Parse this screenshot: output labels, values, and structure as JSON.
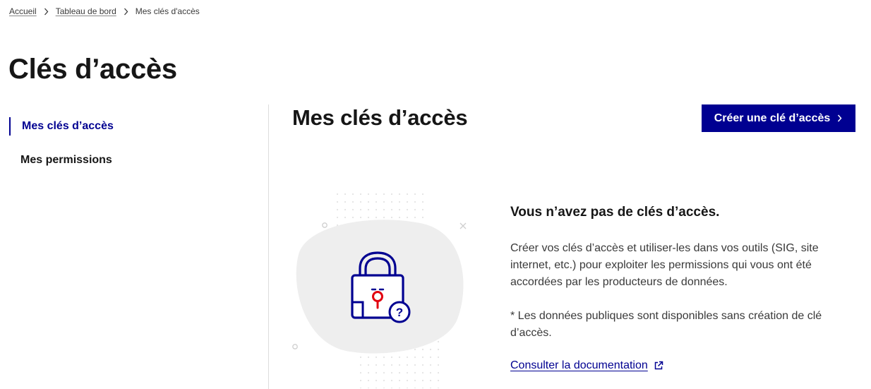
{
  "breadcrumb": {
    "items": [
      "Accueil",
      "Tableau de bord"
    ],
    "current": "Mes clés d'accès"
  },
  "page": {
    "title": "Clés d’accès"
  },
  "sidebar": {
    "items": [
      {
        "label": "Mes clés d’accès",
        "active": true
      },
      {
        "label": "Mes permissions",
        "active": false
      }
    ]
  },
  "main": {
    "title": "Mes clés d’accès",
    "create_button_label": "Créer une clé d’accès",
    "empty_state": {
      "title": "Vous n’avez pas de clés d’accès.",
      "description": "Créer vos clés d’accès et utiliser-les dans vos outils (SIG, site internet, etc.) pour exploiter les permissions qui vous ont été accordées par les producteurs de données.",
      "note": "* Les données publiques sont disponibles sans création de clé d’accès.",
      "doc_link_label": "Consulter la documentation"
    },
    "illustration_icon": "locked-padlock-question-icon"
  },
  "colors": {
    "primary": "#000091",
    "accent_red": "#e1000f",
    "text": "#161616",
    "blob": "#eeeeee",
    "divider": "#dddddd"
  }
}
